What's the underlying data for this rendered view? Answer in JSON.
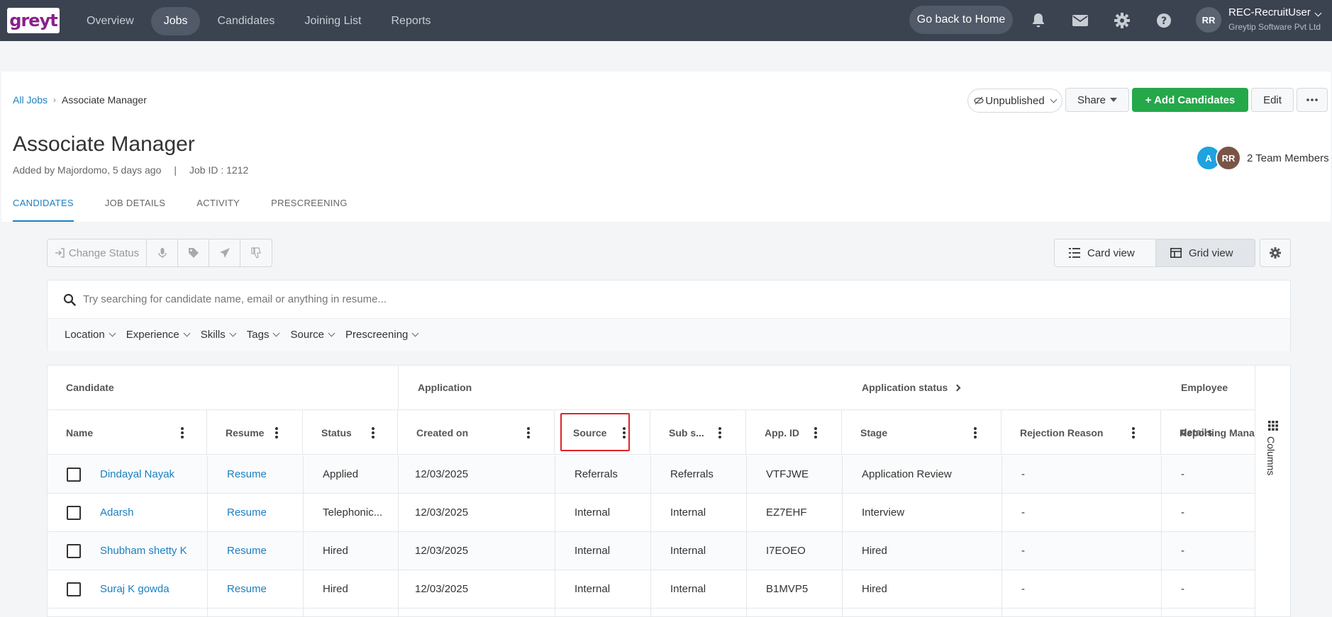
{
  "logo": "greyt",
  "nav": {
    "items": [
      "Overview",
      "Jobs",
      "Candidates",
      "Joining List",
      "Reports"
    ],
    "active": "Jobs",
    "go_home": "Go back to Home",
    "user_initials": "RR",
    "user_name": "REC-RecruitUser",
    "user_org": "Greytip Software Pvt Ltd"
  },
  "breadcrumb": {
    "root": "All Jobs",
    "current": "Associate Manager"
  },
  "job": {
    "title": "Associate Manager",
    "added_by": "Added by Majordomo, 5 days ago",
    "separator": "|",
    "job_id": "Job ID : 1212"
  },
  "actions": {
    "unpublished": "Unpublished",
    "share": "Share",
    "add_candidates": "+ Add Candidates",
    "edit": "Edit"
  },
  "team": {
    "members": [
      {
        "initials": "A",
        "color": "#1ea2e0"
      },
      {
        "initials": "RR",
        "color": "#7a5547"
      }
    ],
    "label": "2 Team Members"
  },
  "tabs": [
    "CANDIDATES",
    "JOB DETAILS",
    "ACTIVITY",
    "PRESCREENING"
  ],
  "toolbar": {
    "change_status": "Change Status"
  },
  "views": {
    "card": "Card view",
    "grid": "Grid view",
    "active": "grid"
  },
  "search": {
    "placeholder": "Try searching for candidate name, email or anything in resume..."
  },
  "filters": [
    "Location",
    "Experience",
    "Skills",
    "Tags",
    "Source",
    "Prescreening"
  ],
  "grid": {
    "groups": [
      "Candidate",
      "Application",
      "Application status",
      "Employee details"
    ],
    "columns": [
      "Name",
      "Resume",
      "Status",
      "Created on",
      "Source",
      "Sub s...",
      "App. ID",
      "Stage",
      "Rejection Reason",
      "Reporting Manag..."
    ],
    "rows": [
      {
        "name": "Dindayal Nayak",
        "resume": "Resume",
        "status": "Applied",
        "created": "12/03/2025",
        "source": "Referrals",
        "sub_source": "Referrals",
        "app_id": "VTFJWE",
        "stage": "Application Review",
        "rejection": "-",
        "manager": "-"
      },
      {
        "name": "Adarsh",
        "resume": "Resume",
        "status": "Telephonic...",
        "created": "12/03/2025",
        "source": "Internal",
        "sub_source": "Internal",
        "app_id": "EZ7EHF",
        "stage": "Interview",
        "rejection": "-",
        "manager": "-"
      },
      {
        "name": "Shubham shetty K",
        "resume": "Resume",
        "status": "Hired",
        "created": "12/03/2025",
        "source": "Internal",
        "sub_source": "Internal",
        "app_id": "I7EOEO",
        "stage": "Hired",
        "rejection": "-",
        "manager": "-"
      },
      {
        "name": "Suraj K gowda",
        "resume": "Resume",
        "status": "Hired",
        "created": "12/03/2025",
        "source": "Internal",
        "sub_source": "Internal",
        "app_id": "B1MVP5",
        "stage": "Hired",
        "rejection": "-",
        "manager": "-"
      }
    ],
    "columns_toggle": "Columns"
  },
  "colors": {
    "nav_bg": "#3b4350",
    "accent": "#1a7fc1",
    "primary": "#24a84a",
    "highlight": "#d9262c"
  }
}
